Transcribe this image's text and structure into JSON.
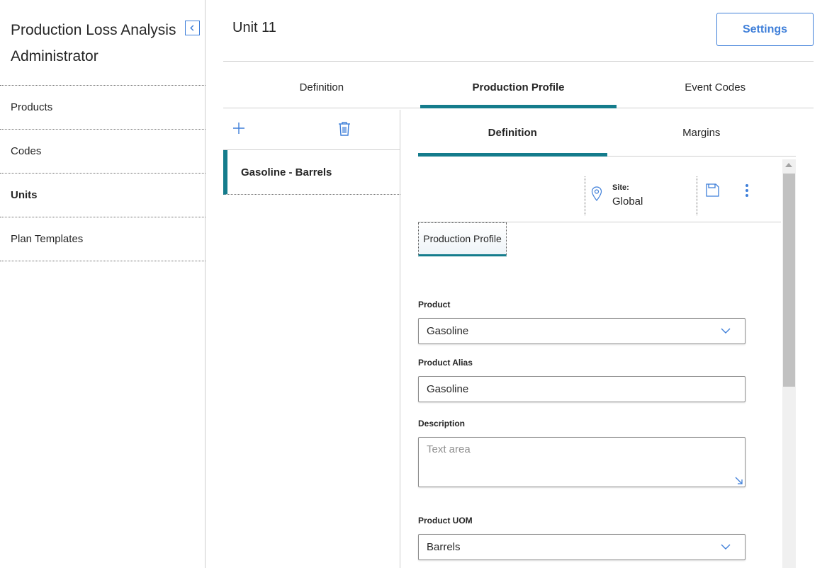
{
  "sidebar": {
    "title": "Production Loss Analysis Administrator",
    "items": [
      {
        "label": "Products"
      },
      {
        "label": "Codes"
      },
      {
        "label": "Units"
      },
      {
        "label": "Plan Templates"
      }
    ],
    "active_item": "Units"
  },
  "header": {
    "title": "Unit 11",
    "settings_label": "Settings"
  },
  "tabs": [
    {
      "label": "Definition"
    },
    {
      "label": "Production Profile"
    },
    {
      "label": "Event Codes"
    }
  ],
  "active_tab": "Production Profile",
  "list": {
    "items": [
      {
        "label": "Gasoline - Barrels"
      }
    ]
  },
  "detail": {
    "sub_tabs": [
      {
        "label": "Definition"
      },
      {
        "label": "Margins"
      }
    ],
    "active_sub_tab": "Definition",
    "site": {
      "label": "Site:",
      "value": "Global"
    },
    "form_tab_label": "Production Profile",
    "fields": {
      "product": {
        "label": "Product",
        "value": "Gasoline"
      },
      "product_alias": {
        "label": "Product Alias",
        "value": "Gasoline"
      },
      "description": {
        "label": "Description",
        "placeholder": "Text area"
      },
      "product_uom": {
        "label": "Product UOM",
        "value": "Barrels"
      }
    }
  },
  "colors": {
    "accent": "#147c8c",
    "link_blue": "#3f7fd9"
  },
  "icons": [
    "chevron-left-icon",
    "plus-icon",
    "trash-icon",
    "map-pin-icon",
    "save-icon",
    "more-vertical-icon",
    "chevron-down-icon",
    "resize-icon"
  ]
}
